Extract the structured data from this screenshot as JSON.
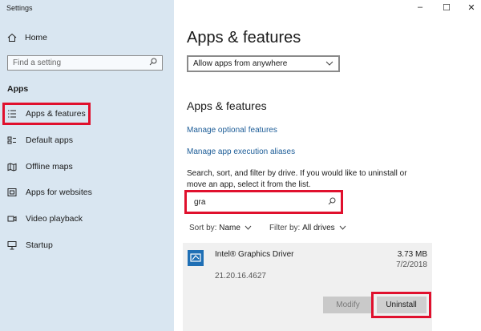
{
  "window": {
    "title": "Settings",
    "controls": [
      "–",
      "☐",
      "✕"
    ]
  },
  "sidebar": {
    "home_label": "Home",
    "search_placeholder": "Find a setting",
    "section": "Apps",
    "items": [
      {
        "label": "Apps & features",
        "icon": "list-icon"
      },
      {
        "label": "Default apps",
        "icon": "default-apps-icon"
      },
      {
        "label": "Offline maps",
        "icon": "map-icon"
      },
      {
        "label": "Apps for websites",
        "icon": "websites-icon"
      },
      {
        "label": "Video playback",
        "icon": "video-icon"
      },
      {
        "label": "Startup",
        "icon": "startup-icon"
      }
    ]
  },
  "main": {
    "title": "Apps & features",
    "install_dropdown": "Allow apps from anywhere",
    "subtitle": "Apps & features",
    "links": [
      "Manage optional features",
      "Manage app execution aliases"
    ],
    "description": "Search, sort, and filter by drive. If you would like to uninstall or move an app, select it from the list.",
    "search_value": "gra",
    "sort_label": "Sort by:",
    "sort_value": "Name",
    "filter_label": "Filter by:",
    "filter_value": "All drives",
    "app": {
      "name": "Intel® Graphics Driver",
      "version": "21.20.16.4627",
      "size": "3.73 MB",
      "date": "7/2/2018",
      "modify_label": "Modify",
      "uninstall_label": "Uninstall"
    }
  },
  "colors": {
    "sidebar_bg": "#d9e6f1",
    "highlight": "#e0102d",
    "link": "#1c5c97"
  }
}
